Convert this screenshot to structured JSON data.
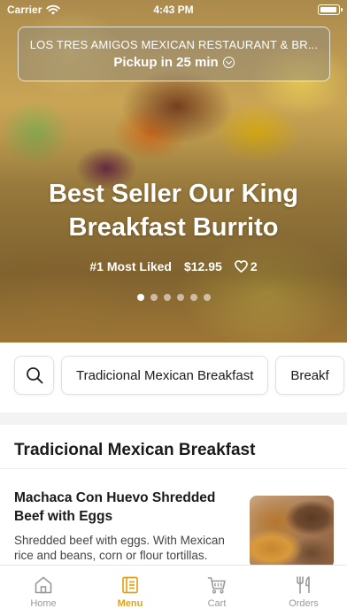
{
  "status_bar": {
    "carrier": "Carrier",
    "time": "4:43 PM"
  },
  "restaurant": {
    "name": "LOS TRES AMIGOS MEXICAN RESTAURANT & BR...",
    "pickup": "Pickup in 25 min"
  },
  "hero": {
    "title": "Best Seller Our King Breakfast Burrito",
    "badge": "#1 Most Liked",
    "price": "$12.95",
    "likes": "2",
    "slide_count": 6,
    "active_slide": 0
  },
  "categories": [
    "Tradicional Mexican Breakfast",
    "Breakf"
  ],
  "section": {
    "title": "Tradicional Mexican Breakfast"
  },
  "menu_items": [
    {
      "name": "Machaca Con Huevo Shredded Beef with Eggs",
      "description": "Shredded beef with eggs. With Mexican rice and beans, corn or flour tortillas."
    }
  ],
  "tabs": [
    {
      "label": "Home",
      "icon": "home-icon",
      "active": false
    },
    {
      "label": "Menu",
      "icon": "menu-icon",
      "active": true
    },
    {
      "label": "Cart",
      "icon": "cart-icon",
      "active": false
    },
    {
      "label": "Orders",
      "icon": "orders-icon",
      "active": false
    }
  ],
  "colors": {
    "accent": "#e3a21a",
    "inactive_tab": "#9a9a9a"
  }
}
